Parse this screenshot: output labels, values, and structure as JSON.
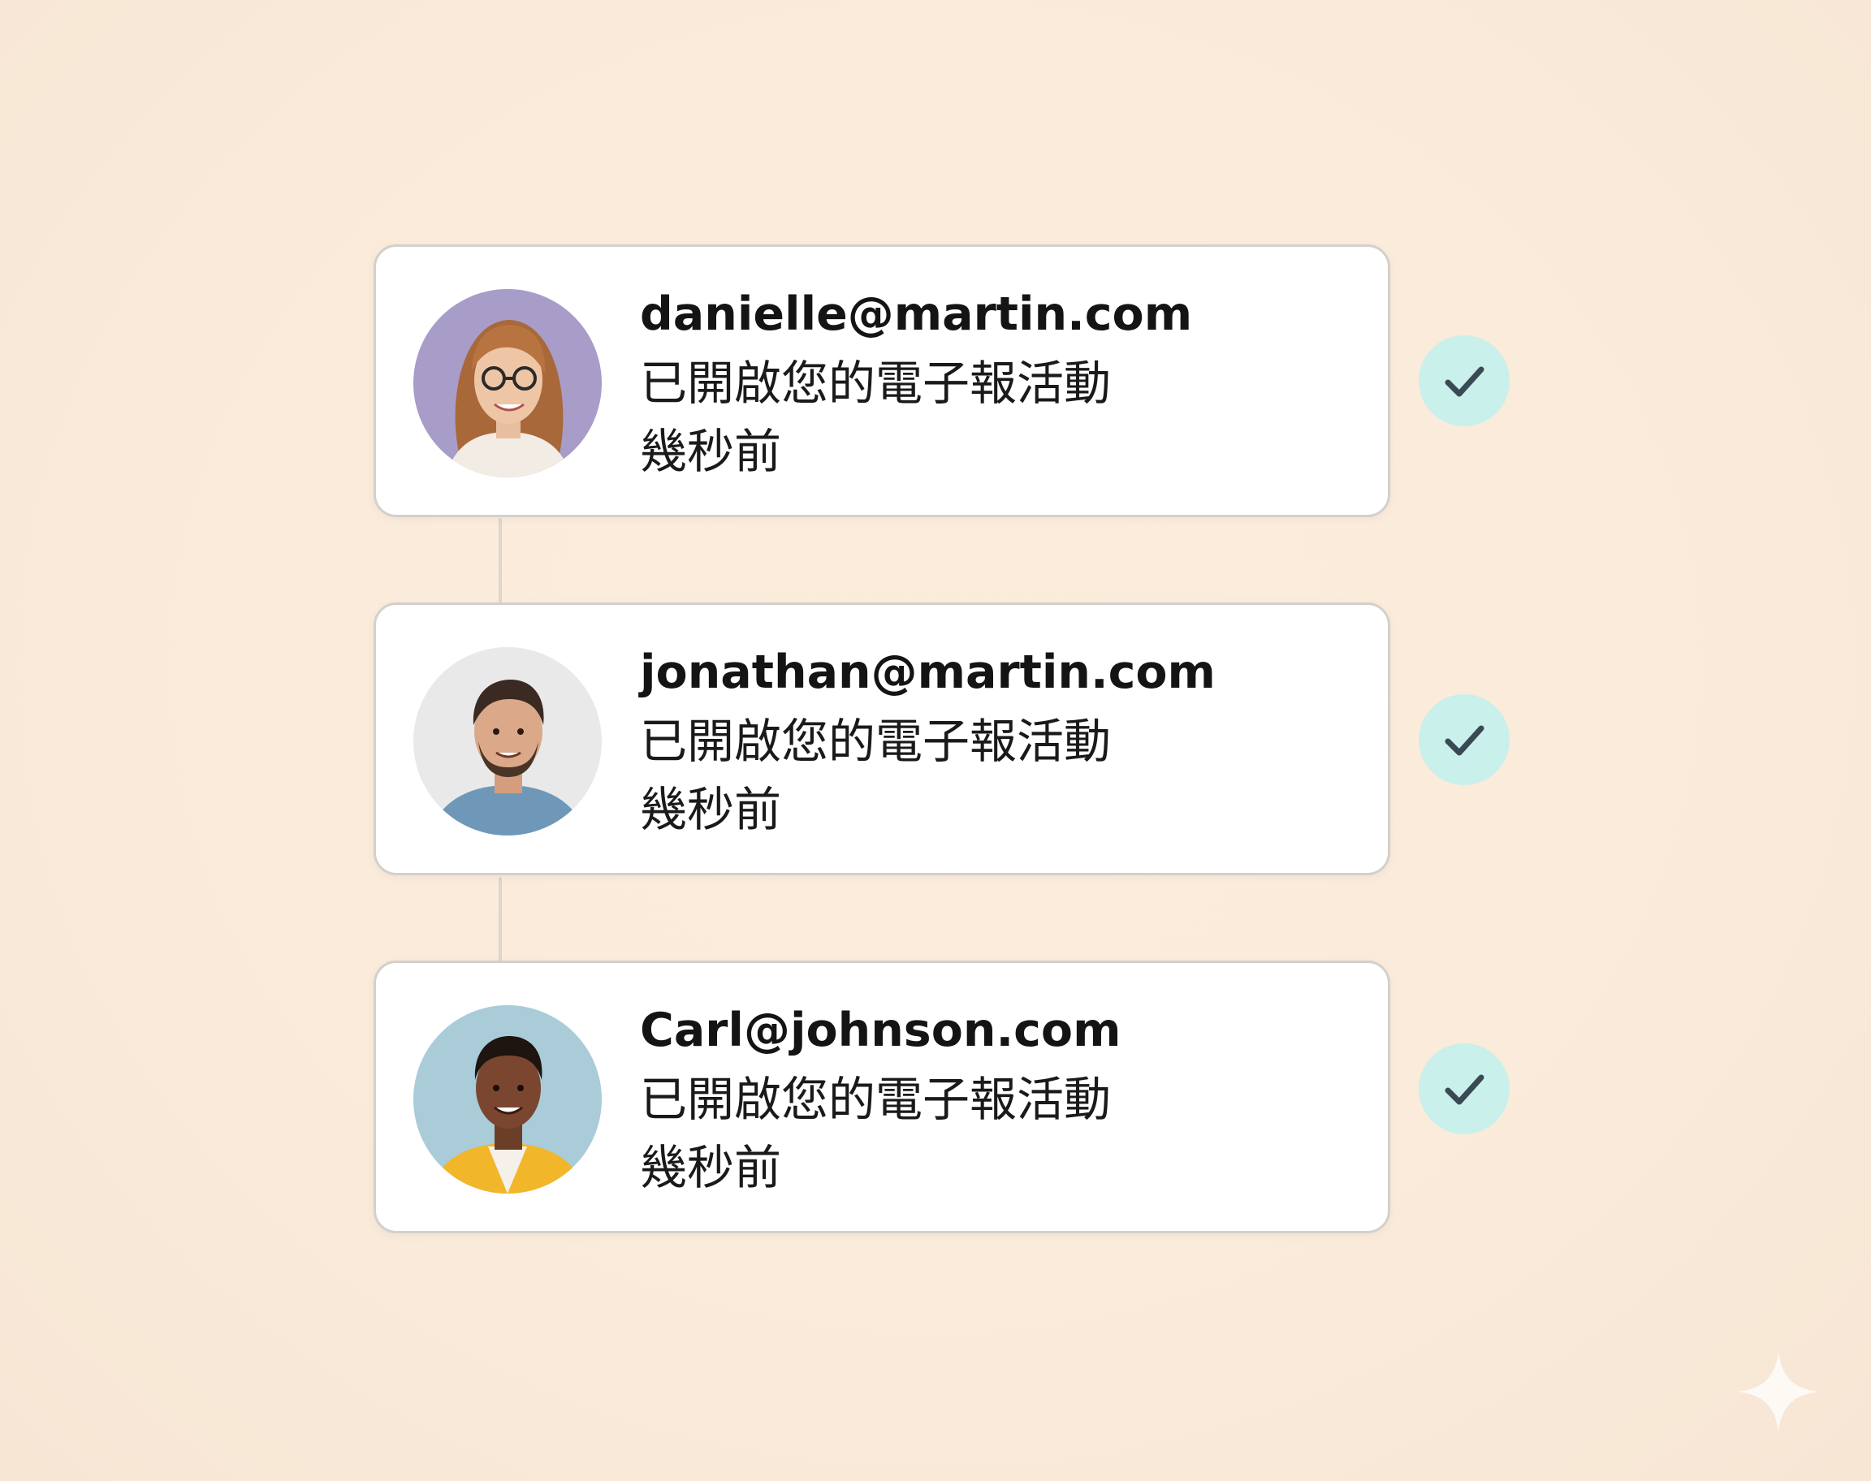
{
  "accent_colors": {
    "background": "#faebdb",
    "card": "#ffffff",
    "card_border": "#d3d0cc",
    "check_badge": "#c9f0eb",
    "check_mark": "#3a4a55"
  },
  "activity_items": [
    {
      "email": "danielle@martin.com",
      "activity": "已開啟您的電子報活動",
      "time": "幾秒前",
      "avatar": "woman-with-glasses-avatar",
      "status_icon": "check-icon"
    },
    {
      "email": "jonathan@martin.com",
      "activity": "已開啟您的電子報活動",
      "time": "幾秒前",
      "avatar": "man-blue-shirt-avatar",
      "status_icon": "check-icon"
    },
    {
      "email": "Carl@johnson.com",
      "activity": "已開啟您的電子報活動",
      "time": "幾秒前",
      "avatar": "man-yellow-jacket-avatar",
      "status_icon": "check-icon"
    }
  ],
  "watermark_icon": "sparkle-icon"
}
